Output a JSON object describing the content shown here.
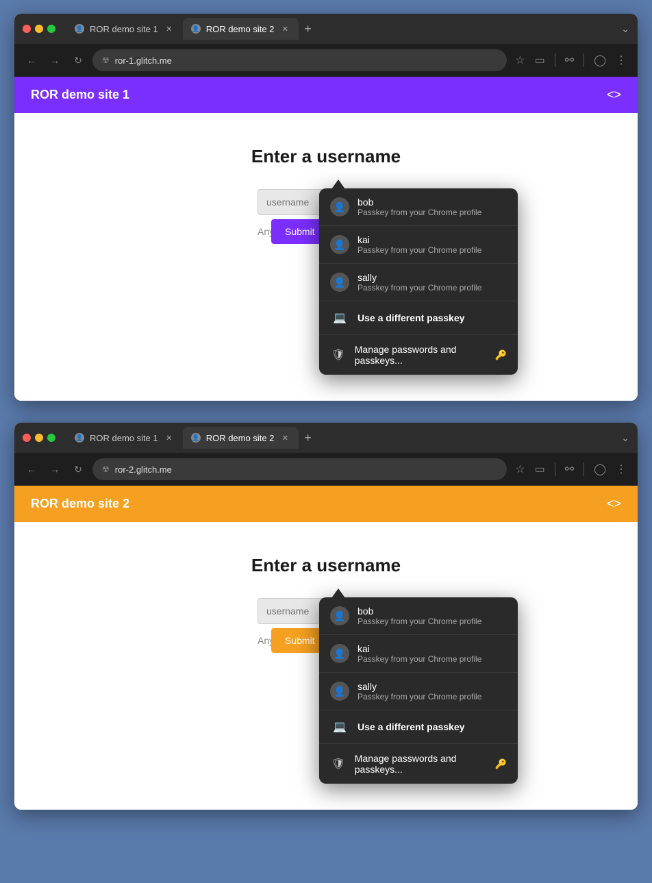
{
  "browser1": {
    "tab1": {
      "label": "ROR demo site 1",
      "active": false
    },
    "tab2": {
      "label": "ROR demo site 2",
      "active": true
    },
    "url": "ror-1.glitch.me",
    "site_title": "ROR demo site 1",
    "header_color": "purple",
    "page_heading": "Enter a username",
    "username_placeholder": "username",
    "any_username_text": "Any usernam...",
    "submit_label": "Submit",
    "passkey_dropdown": {
      "items": [
        {
          "name": "bob",
          "sub": "Passkey from your Chrome profile"
        },
        {
          "name": "kai",
          "sub": "Passkey from your Chrome profile"
        },
        {
          "name": "sally",
          "sub": "Passkey from your Chrome profile"
        }
      ],
      "different_passkey": "Use a different passkey",
      "manage": "Manage passwords and passkeys..."
    }
  },
  "browser2": {
    "tab1": {
      "label": "ROR demo site 1",
      "active": false
    },
    "tab2": {
      "label": "ROR demo site 2",
      "active": true
    },
    "url": "ror-2.glitch.me",
    "site_title": "ROR demo site 2",
    "header_color": "orange",
    "page_heading": "Enter a username",
    "username_placeholder": "username",
    "any_username_text": "Any usernam...",
    "submit_label": "Submit",
    "passkey_dropdown": {
      "items": [
        {
          "name": "bob",
          "sub": "Passkey from your Chrome profile"
        },
        {
          "name": "kai",
          "sub": "Passkey from your Chrome profile"
        },
        {
          "name": "sally",
          "sub": "Passkey from your Chrome profile"
        }
      ],
      "different_passkey": "Use a different passkey",
      "manage": "Manage passwords and passkeys..."
    }
  }
}
